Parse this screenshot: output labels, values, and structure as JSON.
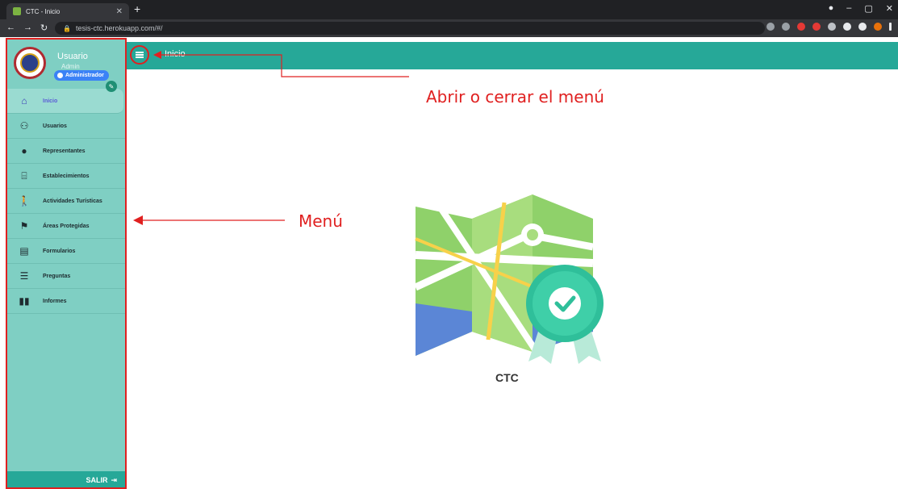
{
  "browser": {
    "tab_title": "CTC - Inicio",
    "url": "tesis-ctc.herokuapp.com/#/"
  },
  "sidebar": {
    "user_name": "Usuario",
    "user_subtitle": "Admin",
    "role_badge": "Administrador",
    "items": [
      {
        "label": "Inicio",
        "icon": "home-icon"
      },
      {
        "label": "Usuarios",
        "icon": "users-icon"
      },
      {
        "label": "Representantes",
        "icon": "representatives-icon"
      },
      {
        "label": "Establecimientos",
        "icon": "store-icon"
      },
      {
        "label": "Actividades Turísticas",
        "icon": "hiking-icon"
      },
      {
        "label": "Áreas Protegidas",
        "icon": "protected-area-icon"
      },
      {
        "label": "Formularios",
        "icon": "clipboard-icon"
      },
      {
        "label": "Preguntas",
        "icon": "list-icon"
      },
      {
        "label": "Informes",
        "icon": "book-icon"
      }
    ],
    "logout_label": "SALIR"
  },
  "topbar": {
    "title": "Inicio"
  },
  "main": {
    "brand_label": "CTC"
  },
  "annotations": {
    "menu_toggle_note": "Abrir o cerrar el menú",
    "menu_note": "Menú"
  },
  "colors": {
    "accent": "#26a898",
    "sidebar": "#7fcfc3",
    "annotation": "#e02020"
  }
}
